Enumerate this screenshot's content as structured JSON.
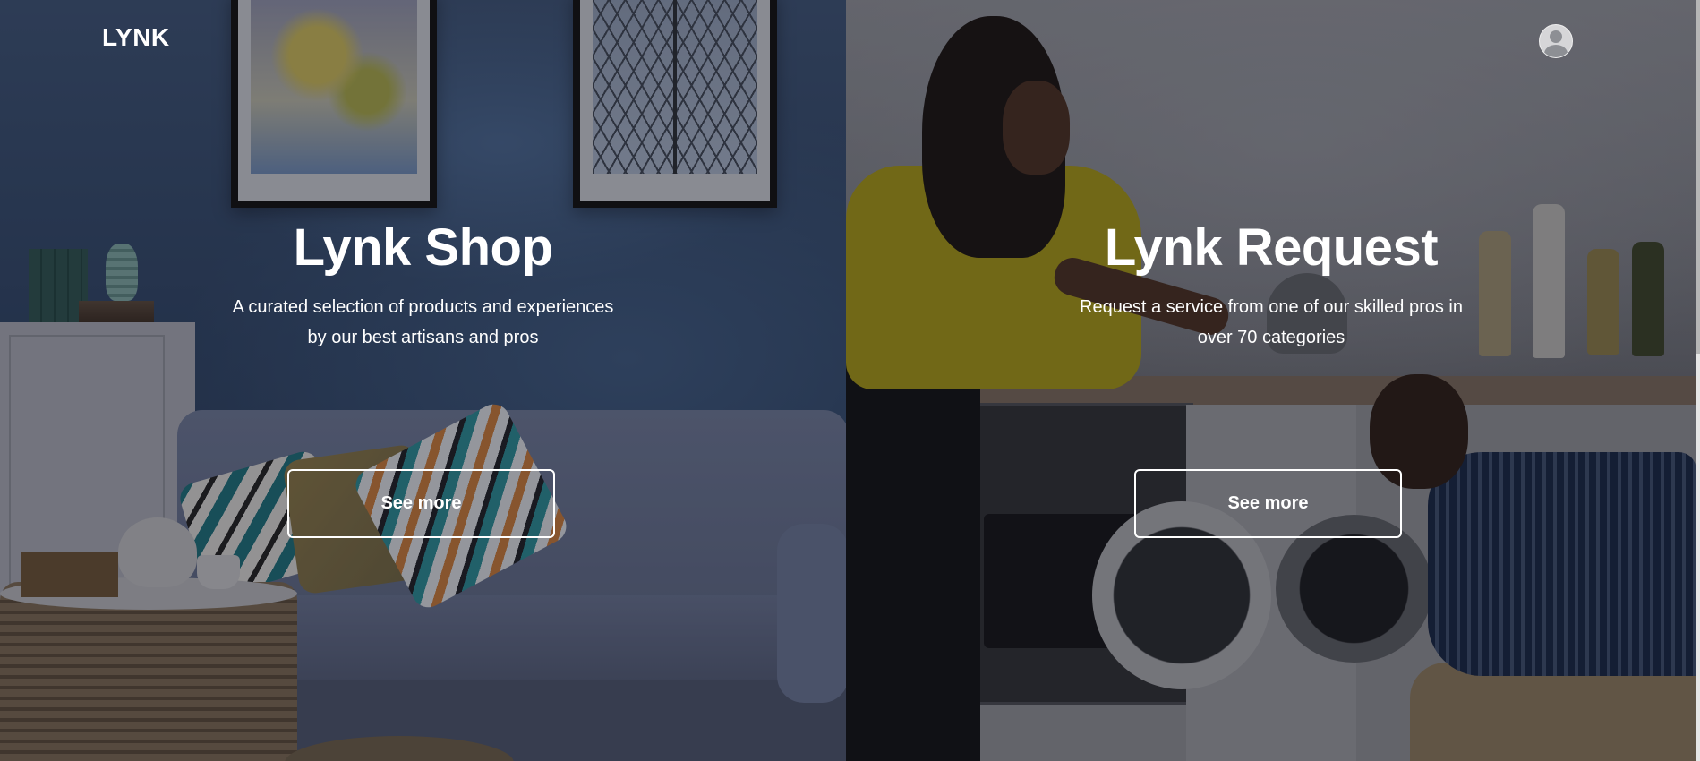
{
  "header": {
    "logo_text": "LYNK",
    "avatar_icon": "user-avatar-icon"
  },
  "panels": {
    "shop": {
      "title": "Lynk Shop",
      "description_line1": "A curated selection of products and experiences",
      "description_line2": "by our best artisans and pros",
      "button_label": "See more"
    },
    "request": {
      "title": "Lynk Request",
      "description_line1": "Request a service from one of our skilled pros in",
      "description_line2": "over 70 categories",
      "button_label": "See more"
    }
  },
  "colors": {
    "text": "#ffffff",
    "button_border": "#ffffff",
    "overlay": "rgba(14,16,22,0.34)"
  }
}
